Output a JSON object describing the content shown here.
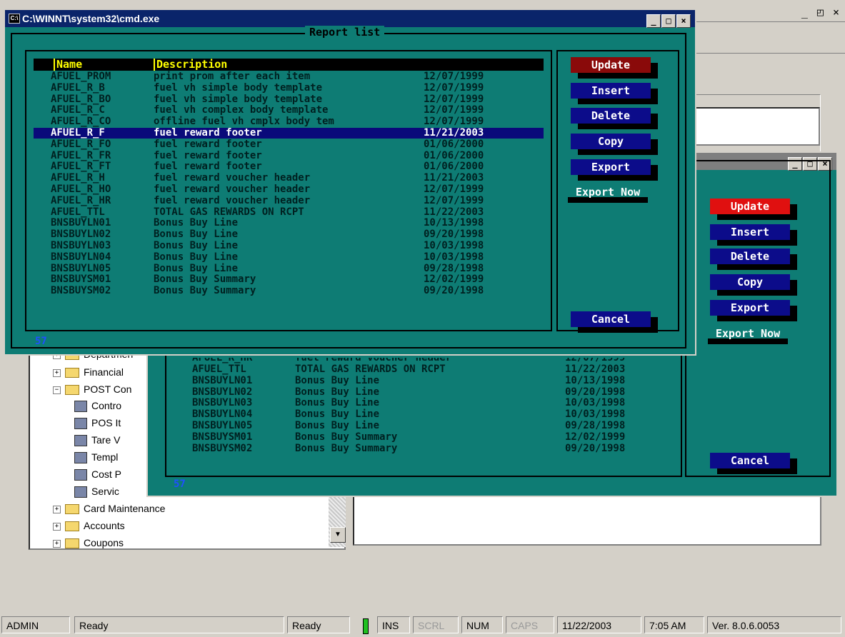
{
  "app": {
    "title_controls": "_ ◰ ×",
    "tree": [
      {
        "label": "Departmen",
        "kind": "folder",
        "expand": "+"
      },
      {
        "label": "Financial",
        "kind": "folder",
        "expand": "+"
      },
      {
        "label": "POST Con",
        "kind": "folder-open",
        "expand": "−"
      },
      {
        "label": "Contro",
        "kind": "doc"
      },
      {
        "label": "POS It",
        "kind": "doc"
      },
      {
        "label": "Tare V",
        "kind": "doc"
      },
      {
        "label": "Templ",
        "kind": "doc"
      },
      {
        "label": "Cost P",
        "kind": "doc"
      },
      {
        "label": "Servic",
        "kind": "doc"
      },
      {
        "label": "Card Maintenance",
        "kind": "folder",
        "expand": "+"
      },
      {
        "label": "Accounts",
        "kind": "folder",
        "expand": "+"
      },
      {
        "label": "Coupons",
        "kind": "folder",
        "expand": "+"
      }
    ]
  },
  "statusbar": {
    "user": "ADMIN",
    "status1": "Ready",
    "status2": "Ready",
    "ins": "INS",
    "scrl": "SCRL",
    "num": "NUM",
    "caps": "CAPS",
    "date": "11/22/2003",
    "time": "7:05 AM",
    "version": "Ver. 8.0.6.0053"
  },
  "console_front": {
    "title": "C:\\WINNT\\system32\\cmd.exe",
    "frame_title": "Report list",
    "col_name": "Name",
    "col_desc": "Description",
    "count": "57",
    "rows": [
      {
        "name": "AFUEL_PROM",
        "desc": "print prom after each item",
        "date": "12/07/1999"
      },
      {
        "name": "AFUEL_R_B",
        "desc": "fuel vh simple body template",
        "date": "12/07/1999"
      },
      {
        "name": "AFUEL_R_BO",
        "desc": "fuel vh simple body template",
        "date": "12/07/1999"
      },
      {
        "name": "AFUEL_R_C",
        "desc": "fuel vh complex body template",
        "date": "12/07/1999"
      },
      {
        "name": "AFUEL_R_CO",
        "desc": "offline fuel vh cmplx body tem",
        "date": "12/07/1999"
      },
      {
        "name": "AFUEL_R_F",
        "desc": "fuel reward footer",
        "date": "11/21/2003"
      },
      {
        "name": "AFUEL_R_FO",
        "desc": "fuel reward footer",
        "date": "01/06/2000"
      },
      {
        "name": "AFUEL_R_FR",
        "desc": "fuel reward footer",
        "date": "01/06/2000"
      },
      {
        "name": "AFUEL_R_FT",
        "desc": "fuel reward footer",
        "date": "01/06/2000"
      },
      {
        "name": "AFUEL_R_H",
        "desc": "fuel reward voucher header",
        "date": "11/21/2003"
      },
      {
        "name": "AFUEL_R_HO",
        "desc": "fuel reward voucher header",
        "date": "12/07/1999"
      },
      {
        "name": "AFUEL_R_HR",
        "desc": "fuel reward voucher header",
        "date": "12/07/1999"
      },
      {
        "name": "AFUEL_TTL",
        "desc": "TOTAL GAS REWARDS ON RCPT",
        "date": "11/22/2003"
      },
      {
        "name": "BNSBUYLN01",
        "desc": "Bonus Buy Line",
        "date": "10/13/1998"
      },
      {
        "name": "BNSBUYLN02",
        "desc": "Bonus Buy Line",
        "date": "09/20/1998"
      },
      {
        "name": "BNSBUYLN03",
        "desc": "Bonus Buy Line",
        "date": "10/03/1998"
      },
      {
        "name": "BNSBUYLN04",
        "desc": "Bonus Buy Line",
        "date": "10/03/1998"
      },
      {
        "name": "BNSBUYLN05",
        "desc": "Bonus Buy Line",
        "date": "09/28/1998"
      },
      {
        "name": "BNSBUYSM01",
        "desc": "Bonus Buy Summary",
        "date": "12/02/1999"
      },
      {
        "name": "BNSBUYSM02",
        "desc": "Bonus Buy Summary",
        "date": "09/20/1998"
      }
    ],
    "buttons": {
      "update": "Update",
      "insert": "Insert",
      "delete": "Delete",
      "copy": "Copy",
      "export": "Export",
      "export_now": "Export Now",
      "cancel": "Cancel"
    }
  },
  "console_back": {
    "count": "57",
    "partial_row": {
      "name": "AFUEL_R_HR",
      "desc": "fuel reward voucher header",
      "date": "12/07/1999"
    },
    "rows": [
      {
        "name": "AFUEL_TTL",
        "desc": "TOTAL GAS REWARDS ON RCPT",
        "date": "11/22/2003"
      },
      {
        "name": "BNSBUYLN01",
        "desc": "Bonus Buy Line",
        "date": "10/13/1998"
      },
      {
        "name": "BNSBUYLN02",
        "desc": "Bonus Buy Line",
        "date": "09/20/1998"
      },
      {
        "name": "BNSBUYLN03",
        "desc": "Bonus Buy Line",
        "date": "10/03/1998"
      },
      {
        "name": "BNSBUYLN04",
        "desc": "Bonus Buy Line",
        "date": "10/03/1998"
      },
      {
        "name": "BNSBUYLN05",
        "desc": "Bonus Buy Line",
        "date": "09/28/1998"
      },
      {
        "name": "BNSBUYSM01",
        "desc": "Bonus Buy Summary",
        "date": "12/02/1999"
      },
      {
        "name": "BNSBUYSM02",
        "desc": "Bonus Buy Summary",
        "date": "09/20/1998"
      }
    ],
    "buttons": {
      "update": "Update",
      "insert": "Insert",
      "delete": "Delete",
      "copy": "Copy",
      "export": "Export",
      "export_now": "Export Now",
      "cancel": "Cancel"
    }
  }
}
